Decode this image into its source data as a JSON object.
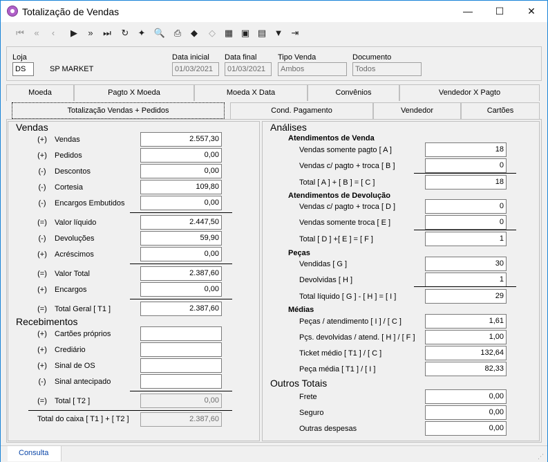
{
  "window": {
    "title": "Totalização de Vendas",
    "minimize": "—",
    "maximize": "☐",
    "close": "✕"
  },
  "toolbar": [
    {
      "name": "first-icon",
      "glyph": "⏮",
      "disabled": true
    },
    {
      "name": "prev-page-icon",
      "glyph": "«",
      "disabled": true
    },
    {
      "name": "prev-icon",
      "glyph": "‹",
      "disabled": true
    },
    {
      "name": "next-icon",
      "glyph": "▶",
      "disabled": false
    },
    {
      "name": "next-page-icon",
      "glyph": "»",
      "disabled": false
    },
    {
      "name": "last-icon",
      "glyph": "⏭",
      "disabled": false
    },
    {
      "name": "refresh-icon",
      "glyph": "↻",
      "disabled": false
    },
    {
      "name": "wand-icon",
      "glyph": "✦",
      "disabled": false
    },
    {
      "name": "preview-icon",
      "glyph": "🔍",
      "disabled": false
    },
    {
      "name": "print-icon",
      "glyph": "⎙",
      "disabled": false
    },
    {
      "name": "eraser-icon",
      "glyph": "◆",
      "disabled": false
    },
    {
      "name": "goto-icon",
      "glyph": "◇",
      "disabled": true
    },
    {
      "name": "filter-box-icon",
      "glyph": "▦",
      "disabled": false
    },
    {
      "name": "report-icon",
      "glyph": "▣",
      "disabled": false
    },
    {
      "name": "export-icon",
      "glyph": "▤",
      "disabled": false
    },
    {
      "name": "funnel-icon",
      "glyph": "▼",
      "disabled": false
    },
    {
      "name": "exit-icon",
      "glyph": "⇥",
      "disabled": false
    }
  ],
  "header": {
    "loja_label": "Loja",
    "loja_value": "DS",
    "loja_name": "SP MARKET",
    "data_inicial_label": "Data inicial",
    "data_inicial": "01/03/2021",
    "data_final_label": "Data final",
    "data_final": "01/03/2021",
    "tipo_venda_label": "Tipo Venda",
    "tipo_venda": "Ambos",
    "documento_label": "Documento",
    "documento": "Todos"
  },
  "tabs_row1": [
    "Moeda",
    "Pagto X Moeda",
    "Moeda X Data",
    "Convênios",
    "Vendedor X Pagto"
  ],
  "tabs_row2": [
    "Totalização Vendas + Pedidos",
    "Cond. Pagamento",
    "Vendedor",
    "Cartões"
  ],
  "vendas": {
    "title": "Vendas",
    "rows": [
      {
        "op": "(+)",
        "label": "Vendas",
        "value": "2.557,30"
      },
      {
        "op": "(+)",
        "label": "Pedidos",
        "value": "0,00"
      },
      {
        "op": "(-)",
        "label": "Descontos",
        "value": "0,00"
      },
      {
        "op": "(-)",
        "label": "Cortesia",
        "value": "109,80"
      },
      {
        "op": "(-)",
        "label": "Encargos Embutidos",
        "value": "0,00"
      },
      {
        "op": "(=)",
        "label": "Valor líquido",
        "value": "2.447,50"
      },
      {
        "op": "(-)",
        "label": "Devoluções",
        "value": "59,90"
      },
      {
        "op": "(+)",
        "label": "Acréscimos",
        "value": "0,00"
      },
      {
        "op": "(=)",
        "label": "Valor Total",
        "value": "2.387,60"
      },
      {
        "op": "(+)",
        "label": "Encargos",
        "value": "0,00"
      },
      {
        "op": "(=)",
        "label": "Total Geral  [ T1 ]",
        "value": "2.387,60"
      }
    ]
  },
  "recebimentos": {
    "title": "Recebimentos",
    "rows": [
      {
        "op": "(+)",
        "label": "Cartões próprios",
        "value": ""
      },
      {
        "op": "(+)",
        "label": "Crediário",
        "value": ""
      },
      {
        "op": "(+)",
        "label": "Sinal de OS",
        "value": ""
      },
      {
        "op": "(-)",
        "label": "Sinal antecipado",
        "value": ""
      },
      {
        "op": "(=)",
        "label": "Total  [ T2 ]",
        "value": "0,00"
      }
    ],
    "caixa_label": "Total do caixa [ T1 ] + [ T2 ]",
    "caixa_value": "2.387,60"
  },
  "analises": {
    "title": "Análises",
    "atend_venda": {
      "title": "Atendimentos de Venda",
      "rows": [
        {
          "label": "Vendas somente pagto [ A ]",
          "value": "18"
        },
        {
          "label": "Vendas c/ pagto + troca [ B ]",
          "value": "0"
        },
        {
          "label": "Total  [ A ] + [ B ] = [ C ]",
          "value": "18"
        }
      ]
    },
    "atend_devol": {
      "title": "Atendimentos de Devolução",
      "rows": [
        {
          "label": "Vendas c/ pagto + troca [ D ]",
          "value": "0"
        },
        {
          "label": "Vendas somente troca [ E ]",
          "value": "0"
        },
        {
          "label": "Total  [ D ] +[ E ] =  [ F ]",
          "value": "1"
        }
      ]
    },
    "pecas": {
      "title": "Peças",
      "rows": [
        {
          "label": "Vendidas [ G ]",
          "value": "30"
        },
        {
          "label": "Devolvidas [ H ]",
          "value": "1"
        },
        {
          "label": "Total líquido  [ G ] - [ H ] =  [ I ]",
          "value": "29"
        }
      ]
    },
    "medias": {
      "title": "Médias",
      "rows": [
        {
          "label": "Peças / atendimento [ I ] / [ C ]",
          "value": "1,61"
        },
        {
          "label": "Pçs. devolvidas / atend. [ H ] / [ F ]",
          "value": "1,00"
        },
        {
          "label": "Ticket médio [ T1 ] / [ C ]",
          "value": "132,64"
        },
        {
          "label": "Peça média [ T1 ] / [ I ]",
          "value": "82,33"
        }
      ]
    }
  },
  "outros": {
    "title": "Outros Totais",
    "rows": [
      {
        "label": "Frete",
        "value": "0,00"
      },
      {
        "label": "Seguro",
        "value": "0,00"
      },
      {
        "label": "Outras despesas",
        "value": "0,00"
      }
    ]
  },
  "status": {
    "tab": "Consulta"
  }
}
